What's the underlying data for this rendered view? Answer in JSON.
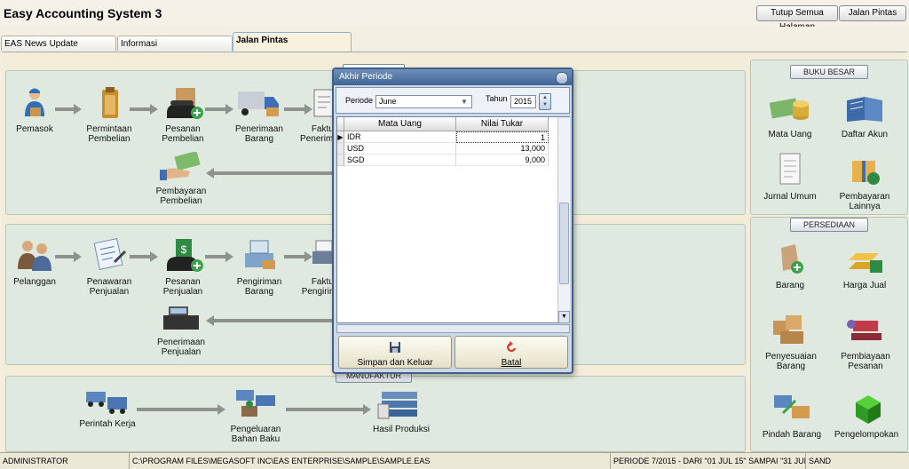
{
  "app": {
    "title": "Easy Accounting System 3"
  },
  "top_buttons": {
    "close_all": "Tutup Semua Halaman",
    "shortcuts": "Jalan Pintas"
  },
  "tabs": [
    {
      "label": "EAS News Update"
    },
    {
      "label": "Informasi"
    },
    {
      "label": "Jalan Pintas"
    }
  ],
  "purchase_flow": {
    "supplier": "Pemasok",
    "request_line1": "Permintaan",
    "request_line2": "Pembelian",
    "order_line1": "Pesanan",
    "order_line2": "Pembelian",
    "receive_line1": "Penerimaan",
    "receive_line2": "Barang",
    "invoice_line1": "Faktur",
    "invoice_line2": "Penerimaan",
    "payment_line1": "Pembayaran",
    "payment_line2": "Pembelian"
  },
  "sales_flow": {
    "customer": "Pelanggan",
    "quote_line1": "Penawaran",
    "quote_line2": "Penjualan",
    "order_line1": "Pesanan",
    "order_line2": "Penjualan",
    "delivery_line1": "Pengiriman",
    "delivery_line2": "Barang",
    "invoice_line1": "Faktur",
    "invoice_line2": "Pengiriman",
    "receipt_line1": "Penerimaan",
    "receipt_line2": "Penjualan"
  },
  "manufacturing": {
    "title": "MANUFAKTUR",
    "work_order": "Perintah Kerja",
    "material_line1": "Pengeluaran",
    "material_line2": "Bahan Baku",
    "output": "Hasil Produksi"
  },
  "ledger": {
    "title": "BUKU BESAR",
    "currency": "Mata Uang",
    "accounts": "Daftar Akun",
    "journal": "Jurnal Umum",
    "other_payment": "Pembayaran Lainnya"
  },
  "inventory": {
    "title": "PERSEDIAAN",
    "item": "Barang",
    "price": "Harga Jual",
    "adjust": "Penyesuaian Barang",
    "order_cost": "Pembiayaan Pesanan",
    "transfer": "Pindah Barang",
    "grouping": "Pengelompokan"
  },
  "dialog": {
    "title": "Akhir Periode",
    "period_label": "Periode",
    "period_value": "June",
    "year_label": "Tahun",
    "year_value": "2015",
    "columns": [
      "Mata Uang",
      "Nilai Tukar"
    ],
    "rows": [
      {
        "currency": "IDR",
        "rate": "1"
      },
      {
        "currency": "USD",
        "rate": "13,000"
      },
      {
        "currency": "SGD",
        "rate": "9,000"
      }
    ],
    "save_button": "Simpan dan Keluar",
    "cancel_button": "Batal"
  },
  "status": {
    "user": "ADMINISTRATOR",
    "path": "C:\\PROGRAM FILES\\MEGASOFT INC\\EAS ENTERPRISE\\SAMPLE\\SAMPLE.EAS",
    "period": "PERIODE 7/2015 - DARI \"01 JUL 15\" SAMPAI \"31 JUL 15\"",
    "db": "SAND"
  },
  "colors": {
    "dialog_title": "#3f6596",
    "panel_bg": "#dfe9df",
    "workspace_bg": "#f2ecd9"
  }
}
